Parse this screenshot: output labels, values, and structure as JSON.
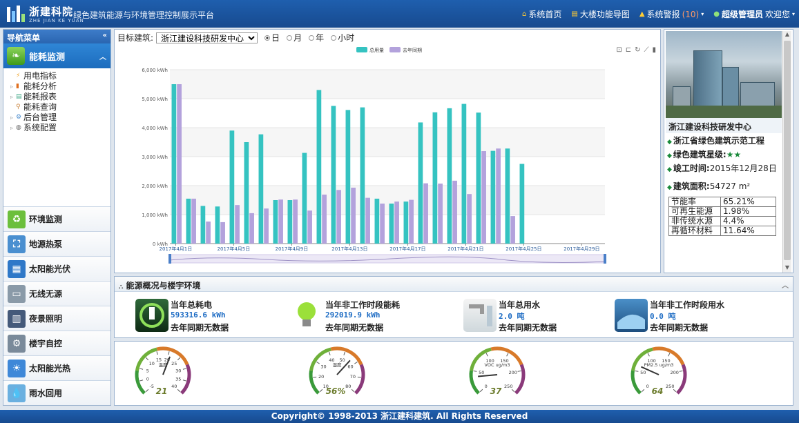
{
  "header": {
    "logo_name": "浙建科院",
    "logo_en": "ZHE JIAN KE YUAN",
    "title": "绿色建筑能源与环境管理控制展示平台",
    "nav": {
      "home": "系统首页",
      "floor_map": "大楼功能导图",
      "alarm": "系统警报",
      "alarm_count": "(10)",
      "user": "超级管理员",
      "welcome": "欢迎您"
    }
  },
  "sidebar": {
    "title": "导航菜单",
    "active_module": "能耗监测",
    "tree": [
      "用电指标",
      "能耗分析",
      "能耗报表",
      "能耗查询",
      "后台管理",
      "系统配置"
    ],
    "modules": [
      "环境监测",
      "地源热泵",
      "太阳能光伏",
      "无线无源",
      "夜景照明",
      "楼宇自控",
      "太阳能光热",
      "雨水回用"
    ]
  },
  "filter": {
    "label": "目标建筑:",
    "building": "浙江建设科技研发中心",
    "options": [
      "日",
      "月",
      "年",
      "小时"
    ],
    "selected": "日"
  },
  "chart_data": {
    "type": "bar",
    "x": [
      "2017年4月1日",
      "2017年4月2日",
      "2017年4月3日",
      "2017年4月4日",
      "2017年4月5日",
      "2017年4月6日",
      "2017年4月7日",
      "2017年4月8日",
      "2017年4月9日",
      "2017年4月10日",
      "2017年4月11日",
      "2017年4月12日",
      "2017年4月13日",
      "2017年4月14日",
      "2017年4月15日",
      "2017年4月16日",
      "2017年4月17日",
      "2017年4月18日",
      "2017年4月19日",
      "2017年4月20日",
      "2017年4月21日",
      "2017年4月22日",
      "2017年4月23日",
      "2017年4月24日",
      "2017年4月25日",
      "2017年4月26日",
      "2017年4月27日",
      "2017年4月28日",
      "2017年4月29日",
      "2017年4月30日"
    ],
    "tick_labels": [
      "2017年4月1日",
      "2017年4月5日",
      "2017年4月9日",
      "2017年4月13日",
      "2017年4月17日",
      "2017年4月21日",
      "2017年4月25日",
      "2017年4月29日"
    ],
    "series": [
      {
        "name": "总用量",
        "color": "#35c3c1",
        "values": [
          5500,
          1550,
          1300,
          1280,
          3900,
          3500,
          3770,
          1500,
          1500,
          3130,
          5300,
          4750,
          4610,
          4700,
          1550,
          1380,
          1450,
          4180,
          4530,
          4670,
          4820,
          4520,
          3200,
          3280,
          2750,
          null,
          null,
          null,
          null,
          null
        ]
      },
      {
        "name": "去年同期",
        "color": "#b3a2dc",
        "values": [
          5500,
          1550,
          760,
          740,
          1330,
          1050,
          1210,
          1520,
          1520,
          1140,
          1690,
          1850,
          1930,
          1580,
          1380,
          1450,
          1510,
          2080,
          2070,
          2170,
          1710,
          3190,
          3280,
          950,
          null,
          null,
          null,
          null,
          null,
          null
        ]
      }
    ],
    "ylim": [
      0,
      6000
    ],
    "yticks": [
      "0 kWh",
      "1,000 kWh",
      "2,000 kWh",
      "3,000 kWh",
      "4,000 kWh",
      "5,000 kWh",
      "6,000 kWh"
    ],
    "legend_position": "top-center",
    "grid": true
  },
  "building": {
    "name": "浙江建设科技研发中心",
    "project": "浙江省绿色建筑示范工程",
    "star_label": "绿色建筑星级:",
    "stars": "★★",
    "completion_label": "竣工时间:",
    "completion": "2015年12月28日",
    "area_label": "建筑面积:",
    "area": "54727 m²",
    "ratios": [
      {
        "label": "节能率",
        "value": "65.21%"
      },
      {
        "label": "可再生能源",
        "value": "1.98%"
      },
      {
        "label": "非传统水源",
        "value": "4.4%"
      },
      {
        "label": "再循环材料",
        "value": "11.64%"
      }
    ]
  },
  "overview": {
    "title": "能源概况与楼宇环境",
    "items": [
      {
        "title": "当年总耗电",
        "value": "593316.6 kWh",
        "note": "去年同期无数据"
      },
      {
        "title": "当年非工作时段能耗",
        "value": "292019.9 kWh",
        "note": "去年同期无数据"
      },
      {
        "title": "当年总用水",
        "value": "2.0 吨",
        "note": "去年同期无数据"
      },
      {
        "title": "当年非工作时段用水",
        "value": "0.0 吨",
        "note": "去年同期无数据"
      }
    ]
  },
  "gauges": [
    {
      "unit": "温度",
      "value": "21",
      "min": -5,
      "max": 40,
      "ticks": [
        "-5",
        "0",
        "5",
        "10",
        "15",
        "20",
        "25",
        "30",
        "35",
        "40"
      ],
      "level": 21
    },
    {
      "unit": "湿度",
      "value": "56%",
      "min": 10,
      "max": 80,
      "ticks": [
        "10",
        "20",
        "30",
        "40",
        "50",
        "60",
        "70",
        "80"
      ],
      "level": 56
    },
    {
      "unit": "VOC ug/m3",
      "value": "37",
      "min": 0,
      "max": 250,
      "ticks": [
        "0",
        "50",
        "100",
        "150",
        "200",
        "250"
      ],
      "level": 37
    },
    {
      "unit": "PM2.5 ug/m3",
      "value": "64",
      "min": 0,
      "max": 250,
      "ticks": [
        "0",
        "50",
        "100",
        "150",
        "200",
        "250"
      ],
      "level": 64
    }
  ],
  "footer": {
    "text": "Copyright© 1998-2013 浙江建科建筑. All Rights Reserved"
  }
}
